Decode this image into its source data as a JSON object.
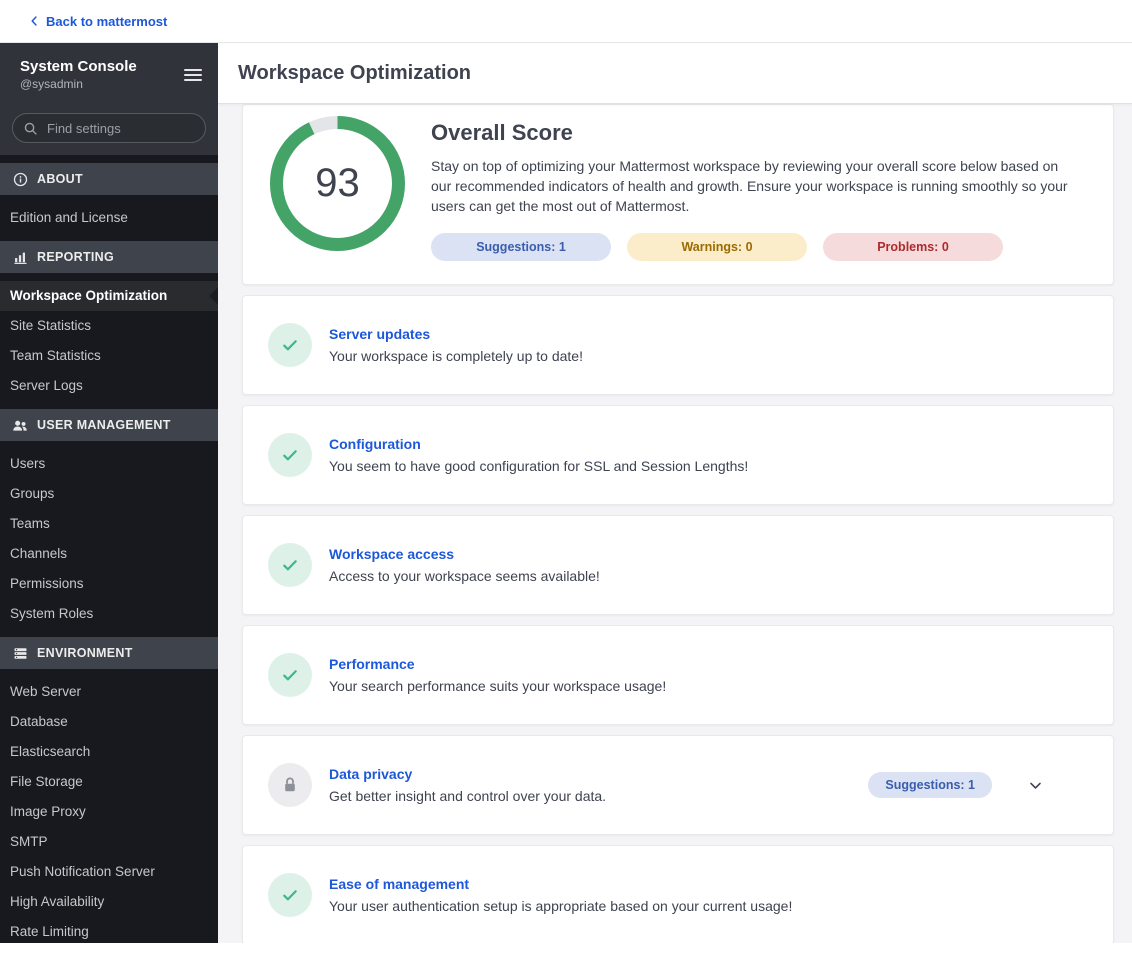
{
  "topbar": {
    "back_label": "Back to mattermost"
  },
  "sidebar": {
    "title": "System Console",
    "subtitle": "@sysadmin",
    "search_placeholder": "Find settings",
    "sections": [
      {
        "label": "ABOUT",
        "icon": "info-icon",
        "items": [
          {
            "label": "Edition and License"
          }
        ]
      },
      {
        "label": "REPORTING",
        "icon": "bar-chart-icon",
        "items": [
          {
            "label": "Workspace Optimization",
            "selected": true
          },
          {
            "label": "Site Statistics"
          },
          {
            "label": "Team Statistics"
          },
          {
            "label": "Server Logs"
          }
        ]
      },
      {
        "label": "USER MANAGEMENT",
        "icon": "users-icon",
        "items": [
          {
            "label": "Users"
          },
          {
            "label": "Groups"
          },
          {
            "label": "Teams"
          },
          {
            "label": "Channels"
          },
          {
            "label": "Permissions"
          },
          {
            "label": "System Roles"
          }
        ]
      },
      {
        "label": "ENVIRONMENT",
        "icon": "server-stack-icon",
        "items": [
          {
            "label": "Web Server"
          },
          {
            "label": "Database"
          },
          {
            "label": "Elasticsearch"
          },
          {
            "label": "File Storage"
          },
          {
            "label": "Image Proxy"
          },
          {
            "label": "SMTP"
          },
          {
            "label": "Push Notification Server"
          },
          {
            "label": "High Availability"
          },
          {
            "label": "Rate Limiting"
          }
        ]
      }
    ]
  },
  "header": {
    "title": "Workspace Optimization"
  },
  "overview": {
    "score": "93",
    "score_max": 100,
    "title": "Overall Score",
    "description": "Stay on top of optimizing your Mattermost workspace by reviewing your overall score below based on our recommended indicators of health and growth. Ensure your workspace is running smoothly so your users can get the most out of Mattermost.",
    "chips": [
      {
        "label": "Suggestions: 1",
        "type": "info"
      },
      {
        "label": "Warnings: 0",
        "type": "warning"
      },
      {
        "label": "Problems: 0",
        "type": "error"
      }
    ]
  },
  "cards": [
    {
      "title": "Server updates",
      "description": "Your workspace is completely up to date!",
      "icon": "check-icon"
    },
    {
      "title": "Configuration",
      "description": "You seem to have good configuration for SSL and Session Lengths!",
      "icon": "check-icon"
    },
    {
      "title": "Workspace access",
      "description": "Access to your workspace seems available!",
      "icon": "check-icon"
    },
    {
      "title": "Performance",
      "description": "Your search performance suits your workspace usage!",
      "icon": "check-icon"
    },
    {
      "title": "Data privacy",
      "description": "Get better insight and control over your data.",
      "icon": "lock-icon",
      "chip": "Suggestions: 1",
      "expandable": true
    },
    {
      "title": "Ease of management",
      "description": "Your user authentication setup is appropriate based on your current usage!",
      "icon": "check-icon"
    }
  ],
  "colors": {
    "accent_blue": "#1c58d9",
    "success_green": "#3db887",
    "ring_green": "#44a467",
    "chip_info_bg": "#dbe2f4",
    "chip_info_text": "#3a5dae",
    "chip_warning_bg": "#fbedca",
    "chip_warning_text": "#9d6a00",
    "chip_error_bg": "#f6dbdd",
    "chip_error_text": "#ad2b2b",
    "sidebar_bg": "#17191e",
    "content_bg": "#f4f4f6"
  }
}
